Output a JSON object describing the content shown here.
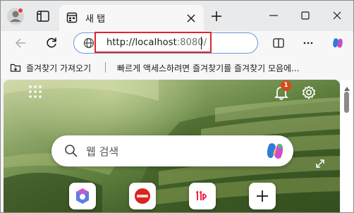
{
  "tab": {
    "title": "새 탭",
    "favicon": "new-tab-favicon",
    "close_icon": "close-icon"
  },
  "titlebar": {
    "icons": [
      "profile-icon",
      "tab-actions-icon",
      "add-icon",
      "minimize-icon",
      "maximize-icon",
      "close-icon"
    ]
  },
  "address_bar": {
    "url_host": "http://localhost",
    "url_port": ":8080/",
    "icon": "globe-icon"
  },
  "toolbar": {
    "icons": [
      "back-icon",
      "reload-icon",
      "split-screen-icon",
      "more-icon",
      "copilot-icon"
    ]
  },
  "favorites_bar": {
    "import_label": "즐겨찾기 가져오기",
    "hint": "빠르게 액세스하려면 즐겨찾기를 즐겨찾기 모음에..."
  },
  "new_tab_page": {
    "notification_count": "1",
    "search_placeholder": "웹 검색",
    "quick_links": [
      "m365-icon",
      "site-icon",
      "11st-icon",
      "add-shortcut-icon"
    ]
  },
  "colors": {
    "accent": "#6a9ad8",
    "highlight_box": "#e0242c",
    "badge": "#d44a1a"
  }
}
